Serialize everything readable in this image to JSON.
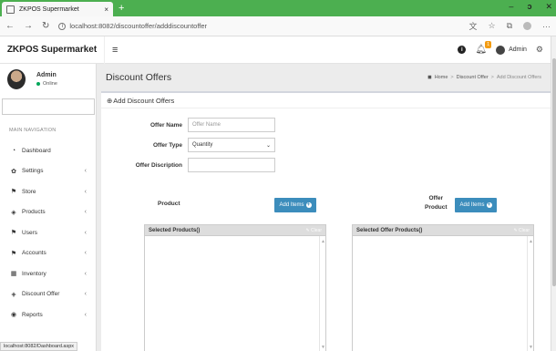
{
  "browser": {
    "tab_title": "ZKPOS Supermarket",
    "tab_close": "×",
    "new_tab": "+",
    "url": "localhost:8082/discountoffer/adddiscountoffer",
    "status_url": "localhost:8082/Dashboard.aspx"
  },
  "header": {
    "brand": "ZKPOS Supermarket",
    "user": "Admin",
    "notification_count": "1"
  },
  "sidebar": {
    "user_name": "Admin",
    "user_status": "Online",
    "nav_header": "MAIN NAVIGATION",
    "items": [
      {
        "label": "Dashboard",
        "icon": "dashboard-icon"
      },
      {
        "label": "Settings",
        "icon": "gear-icon"
      },
      {
        "label": "Store",
        "icon": "store-icon"
      },
      {
        "label": "Products",
        "icon": "products-icon"
      },
      {
        "label": "Users",
        "icon": "users-icon"
      },
      {
        "label": "Accounts",
        "icon": "accounts-icon"
      },
      {
        "label": "Inventory",
        "icon": "inventory-icon"
      },
      {
        "label": "Discount Offer",
        "icon": "plus-icon"
      },
      {
        "label": "Reports",
        "icon": "eye-icon"
      }
    ]
  },
  "content": {
    "title": "Discount Offers",
    "breadcrumb": {
      "home": "Home",
      "parent": "Discount Offer",
      "current": "Add Discount Offers"
    },
    "box_title": "Add Discount Offers",
    "form": {
      "offer_name_label": "Offer Name",
      "offer_name_placeholder": "Offer Name",
      "offer_type_label": "Offer Type",
      "offer_type_value": "Quantity",
      "offer_description_label": "Offer Discription"
    },
    "product_label": "Product",
    "offer_product_label_1": "Offer",
    "offer_product_label_2": "Product",
    "add_items_label": "Add Items",
    "selected_products": "Selected Products()",
    "selected_offer_products": "Selected Offer Products()",
    "clear_label": "Clear"
  },
  "colors": {
    "accent": "#3c8dbc",
    "chrome": "#4caf50",
    "online": "#00a65a"
  }
}
